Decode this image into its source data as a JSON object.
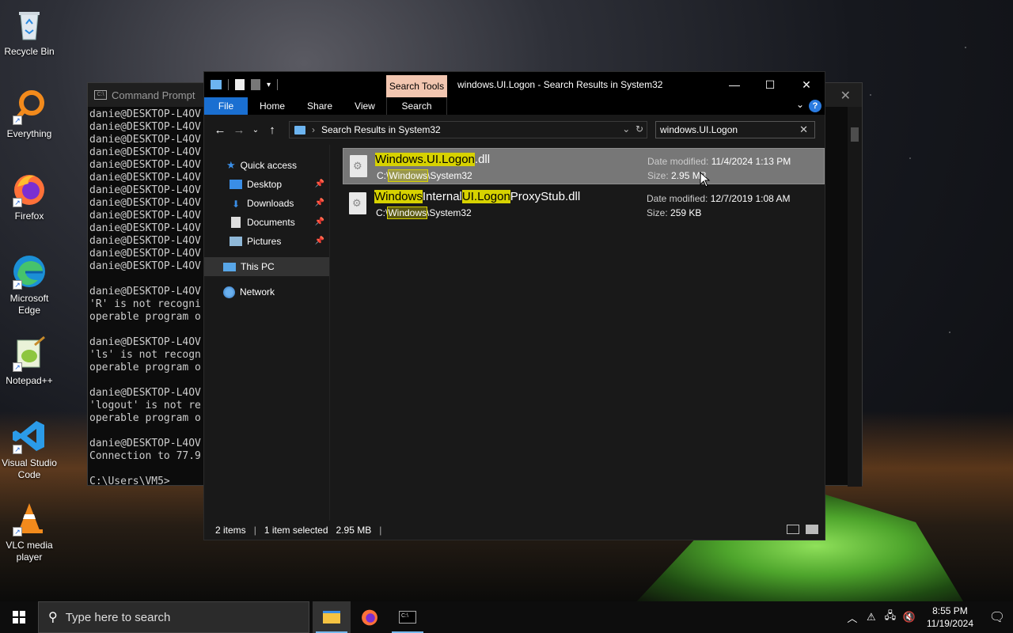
{
  "desktop": {
    "icons": [
      {
        "label": "Recycle Bin",
        "icon": "recycle-bin-icon"
      },
      {
        "label": "Everything",
        "icon": "everything-icon"
      },
      {
        "label": "Firefox",
        "icon": "firefox-icon"
      },
      {
        "label": "Microsoft Edge",
        "icon": "edge-icon"
      },
      {
        "label": "Notepad++",
        "icon": "notepadpp-icon"
      },
      {
        "label": "Visual Studio Code",
        "icon": "vscode-icon"
      },
      {
        "label": "VLC media player",
        "icon": "vlc-icon"
      }
    ]
  },
  "cmd": {
    "title": "Command Prompt",
    "lines": [
      "danie@DESKTOP-L4OV",
      "danie@DESKTOP-L4OV",
      "danie@DESKTOP-L4OV",
      "danie@DESKTOP-L4OV",
      "danie@DESKTOP-L4OV",
      "danie@DESKTOP-L4OV",
      "danie@DESKTOP-L4OV",
      "danie@DESKTOP-L4OV",
      "danie@DESKTOP-L4OV",
      "danie@DESKTOP-L4OV",
      "danie@DESKTOP-L4OV",
      "danie@DESKTOP-L4OV",
      "danie@DESKTOP-L4OV",
      "",
      "danie@DESKTOP-L4OV",
      "'R' is not recogni",
      "operable program o",
      "",
      "danie@DESKTOP-L4OV",
      "'ls' is not recogn",
      "operable program o",
      "",
      "danie@DESKTOP-L4OV",
      "'logout' is not re",
      "operable program o",
      "",
      "danie@DESKTOP-L4OV",
      "Connection to 77.9",
      "",
      "C:\\Users\\VM5>"
    ]
  },
  "explorer": {
    "window_title": "windows.UI.Logon - Search Results in System32",
    "context_tab": "Search Tools",
    "ribbon_tabs": [
      "File",
      "Home",
      "Share",
      "View",
      "Search"
    ],
    "address": "Search Results in System32",
    "search_value": "windows.UI.Logon",
    "nav": {
      "quick_access": "Quick access",
      "desktop": "Desktop",
      "downloads": "Downloads",
      "documents": "Documents",
      "pictures": "Pictures",
      "this_pc": "This PC",
      "network": "Network"
    },
    "results": [
      {
        "name_parts": [
          "Windows.UI.Logon",
          ".dll"
        ],
        "path_parts": [
          "C:\\",
          "Windows",
          "\\System32"
        ],
        "date_label": "Date modified:",
        "date": "11/4/2024 1:13 PM",
        "size_label": "Size:",
        "size": "2.95 MB"
      },
      {
        "name_parts": [
          "Windows",
          "Internal",
          "UI.Logon",
          "ProxyStub.dll"
        ],
        "path_parts": [
          "C:\\",
          "Windows",
          "\\System32"
        ],
        "date_label": "Date modified:",
        "date": "12/7/2019 1:08 AM",
        "size_label": "Size:",
        "size": "259 KB"
      }
    ],
    "status": {
      "items": "2 items",
      "selected": "1 item selected",
      "selected_size": "2.95 MB"
    }
  },
  "taskbar": {
    "search_placeholder": "Type here to search",
    "time": "8:55 PM",
    "date": "11/19/2024"
  }
}
